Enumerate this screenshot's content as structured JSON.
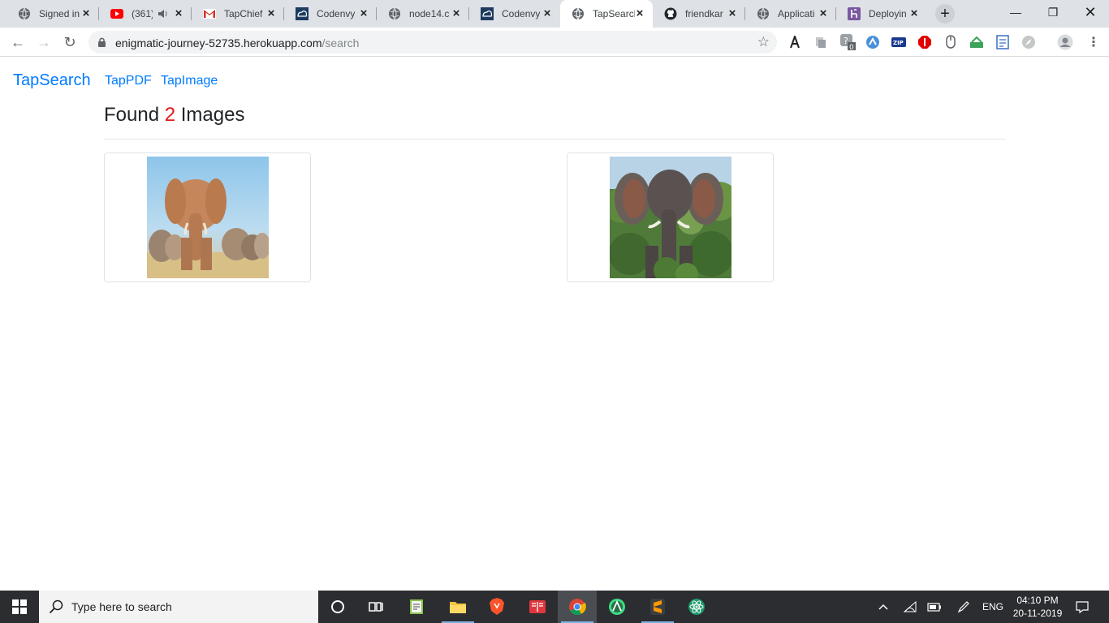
{
  "browser": {
    "tabs": [
      {
        "title": "Signed in",
        "icon": "globe-icon"
      },
      {
        "title": "(361)",
        "icon": "youtube-icon"
      },
      {
        "title": "TapChief",
        "icon": "gmail-icon"
      },
      {
        "title": "Codenvy",
        "icon": "codenvy-icon"
      },
      {
        "title": "node14.c",
        "icon": "globe-icon"
      },
      {
        "title": "Codenvy",
        "icon": "codenvy-icon"
      },
      {
        "title": "TapSearch",
        "icon": "globe-icon",
        "active": true
      },
      {
        "title": "friendkar",
        "icon": "github-icon"
      },
      {
        "title": "Applicati",
        "icon": "globe-icon"
      },
      {
        "title": "Deployin",
        "icon": "heroku-icon"
      }
    ],
    "url_host": "enigmatic-journey-52735.herokuapp.com",
    "url_path": "/search",
    "extension_badge": "0",
    "extension_zip": "ZIP"
  },
  "page": {
    "brand": "TapSearch",
    "nav": [
      "TapPDF",
      "TapImage"
    ],
    "heading_prefix": "Found",
    "heading_count": "2",
    "heading_suffix": "Images",
    "colors": {
      "link": "#007bff",
      "count": "#e3191b"
    }
  },
  "taskbar": {
    "search_placeholder": "Type here to search",
    "language": "ENG",
    "time": "04:10 PM",
    "date": "20-11-2019"
  }
}
